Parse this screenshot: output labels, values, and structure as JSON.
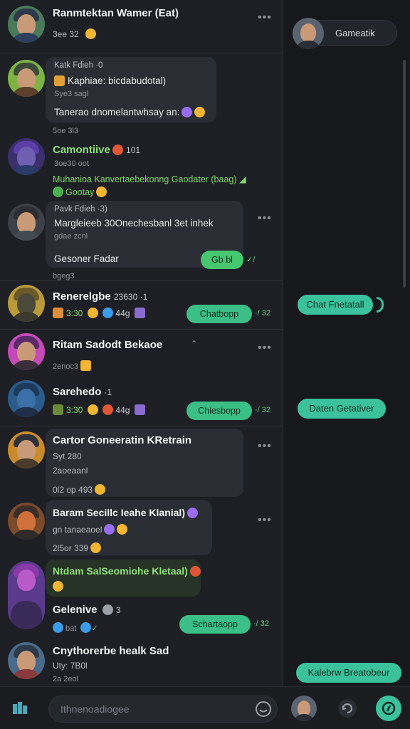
{
  "chats": [
    {
      "name": "Ranmtektan Wamer (Eat)",
      "meta": "3ee 32",
      "name_style": "white"
    },
    {
      "name": "Katk Fdieh ·0",
      "line2": "Kaphiae: bicdabudotal)",
      "line3": "Sye3 sagl",
      "message": "Tanerao dnomelantwhsay an:",
      "time": "5oe 3l3"
    },
    {
      "name": "Camontiive",
      "name_badge": "101",
      "line2": "3oe30 oot",
      "message": "Muhanioa Kanvertaebekonng Gaodater (baag)",
      "message2": "Gootay"
    },
    {
      "name": "Pavk Fdieh ·3)",
      "line2": "Margleieeb 30Onechesbanl 3et inhek",
      "line3": "gdae zcnl",
      "message": "Gesoner Fadar",
      "pill": "Gb bl",
      "time": "bgeg3"
    },
    {
      "name": "Renerelgbe",
      "name_badge": "23630 ·1",
      "stats": [
        "3:30",
        "44g"
      ],
      "pill": "Chatbopp",
      "tick": "·/ 32"
    },
    {
      "name": "Ritam Sadodt Bekaoe",
      "meta": "2enoc3"
    },
    {
      "name": "Sarehedo",
      "name_badge": "·1",
      "stats": [
        "3:30",
        "44g"
      ],
      "pill": "Chlesbopp",
      "tick": "·/ 32"
    },
    {
      "name": "Cartor Goneeratin KRetrain",
      "line2": "Syt 280",
      "line3": "2aoeaanl",
      "meta": "0l2 op 493"
    },
    {
      "name": "Baram Secillc Ieahe Klanial)",
      "line2": "gn tanaeaoel",
      "meta": "2l5or 339"
    },
    {
      "name": "Ntdam SalSeomiohe Kletaal)",
      "name_style": "green"
    },
    {
      "name": "Gelenive",
      "name_badge": "3",
      "meta": "bat",
      "pill": "Schartaopp",
      "tick": "·/ 32"
    },
    {
      "name": "Cnythorerbe healk Sad",
      "line2": "Uty: 7B0l",
      "line3": "2a 2eol"
    }
  ],
  "side": {
    "profile_label": "Gameatik",
    "pills": [
      "Chat Fnetatall",
      "Daten Getativer",
      "Kalebrw Breatobeur"
    ]
  },
  "bottom": {
    "placeholder": "Ithnenoadiogee"
  },
  "colors": {
    "accent_green": "#3bc29d",
    "bubble_bg": "#2a2d33",
    "panel_bg": "#1d1f24"
  }
}
